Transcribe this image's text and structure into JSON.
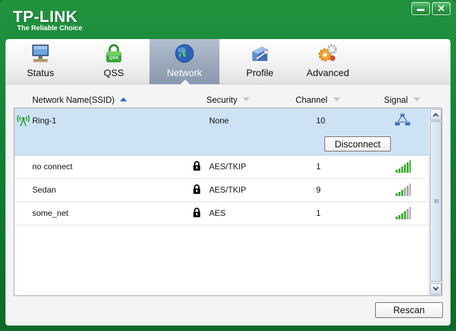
{
  "brand": {
    "name": "TP-LINK",
    "tagline": "The Reliable Choice",
    "color": "#138235"
  },
  "window_controls": {
    "minimize_icon": "minimize-icon",
    "close_glyph": "✕"
  },
  "tabs": [
    {
      "label": "Status",
      "icon": "monitor-icon",
      "active": false
    },
    {
      "label": "QSS",
      "icon": "qss-lock-icon",
      "active": false
    },
    {
      "label": "Network",
      "icon": "globe-icon",
      "active": true
    },
    {
      "label": "Profile",
      "icon": "profile-icon",
      "active": false
    },
    {
      "label": "Advanced",
      "icon": "gears-icon",
      "active": false
    }
  ],
  "columns": {
    "ssid": "Network Name(SSID)",
    "security": "Security",
    "channel": "Channel",
    "signal": "Signal"
  },
  "networks": [
    {
      "ssid": "Ring-1",
      "security": "None",
      "channel": "10",
      "locked": false,
      "connected": true,
      "signal_icon": "ad-hoc-network-icon"
    },
    {
      "ssid": "no connect",
      "security": "AES/TKIP",
      "channel": "1",
      "locked": true,
      "connected": false,
      "signal_bars": 5
    },
    {
      "ssid": "Sedan",
      "security": "AES/TKIP",
      "channel": "9",
      "locked": true,
      "connected": false,
      "signal_bars": 3
    },
    {
      "ssid": "some_net",
      "security": "AES",
      "channel": "1",
      "locked": true,
      "connected": false,
      "signal_bars": 4
    }
  ],
  "buttons": {
    "disconnect": "Disconnect",
    "rescan": "Rescan"
  },
  "colors": {
    "selected_row": "#cde2f5",
    "active_tab": "#98a6ba",
    "signal_green": "#3fae32",
    "signal_gray": "#a8a8a8"
  }
}
